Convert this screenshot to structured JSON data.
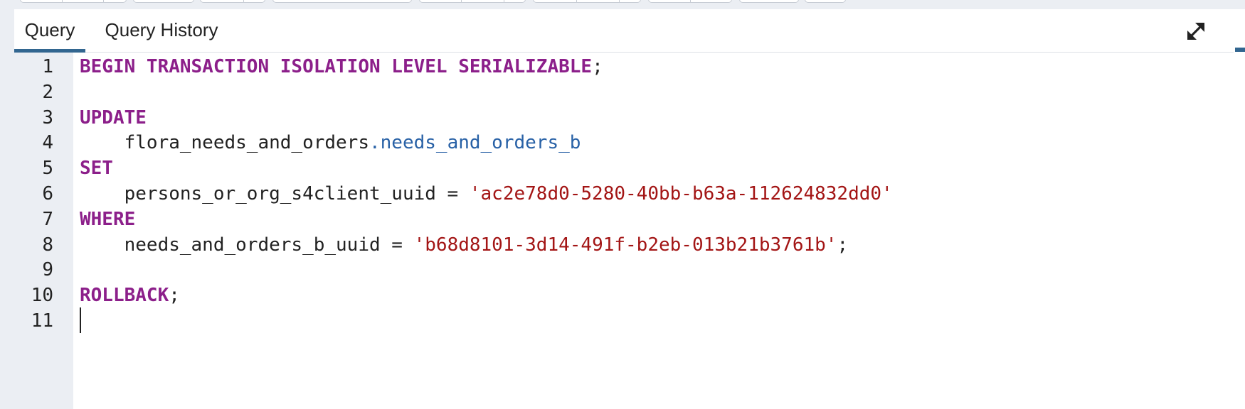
{
  "tabs": [
    {
      "label": "Query",
      "active": true
    },
    {
      "label": "Query History",
      "active": false
    }
  ],
  "expand_icon": "expand-arrows-icon",
  "colors": {
    "keyword": "#8c1f8a",
    "string": "#a31515",
    "property": "#2861a6",
    "accent": "#326690",
    "gutter": "#ebeef3"
  },
  "editor": {
    "lines": [
      {
        "num": "1",
        "tokens": [
          {
            "t": "kw",
            "v": "BEGIN TRANSACTION ISOLATION LEVEL SERIALIZABLE"
          },
          {
            "t": "plain",
            "v": ";"
          }
        ]
      },
      {
        "num": "2",
        "tokens": []
      },
      {
        "num": "3",
        "tokens": [
          {
            "t": "kw",
            "v": "UPDATE"
          }
        ]
      },
      {
        "num": "4",
        "tokens": [
          {
            "t": "plain",
            "v": "    flora_needs_and_orders"
          },
          {
            "t": "prop",
            "v": ".needs_and_orders_b"
          }
        ]
      },
      {
        "num": "5",
        "tokens": [
          {
            "t": "kw",
            "v": "SET"
          }
        ]
      },
      {
        "num": "6",
        "tokens": [
          {
            "t": "plain",
            "v": "    persons_or_org_s4client_uuid = "
          },
          {
            "t": "str",
            "v": "'ac2e78d0-5280-40bb-b63a-112624832dd0'"
          }
        ]
      },
      {
        "num": "7",
        "tokens": [
          {
            "t": "kw",
            "v": "WHERE"
          }
        ]
      },
      {
        "num": "8",
        "tokens": [
          {
            "t": "plain",
            "v": "    needs_and_orders_b_uuid = "
          },
          {
            "t": "str",
            "v": "'b68d8101-3d14-491f-b2eb-013b21b3761b'"
          },
          {
            "t": "plain",
            "v": ";"
          }
        ]
      },
      {
        "num": "9",
        "tokens": []
      },
      {
        "num": "10",
        "tokens": [
          {
            "t": "kw",
            "v": "ROLLBACK"
          },
          {
            "t": "plain",
            "v": ";"
          }
        ]
      },
      {
        "num": "11",
        "tokens": [],
        "cursor": true
      }
    ]
  }
}
